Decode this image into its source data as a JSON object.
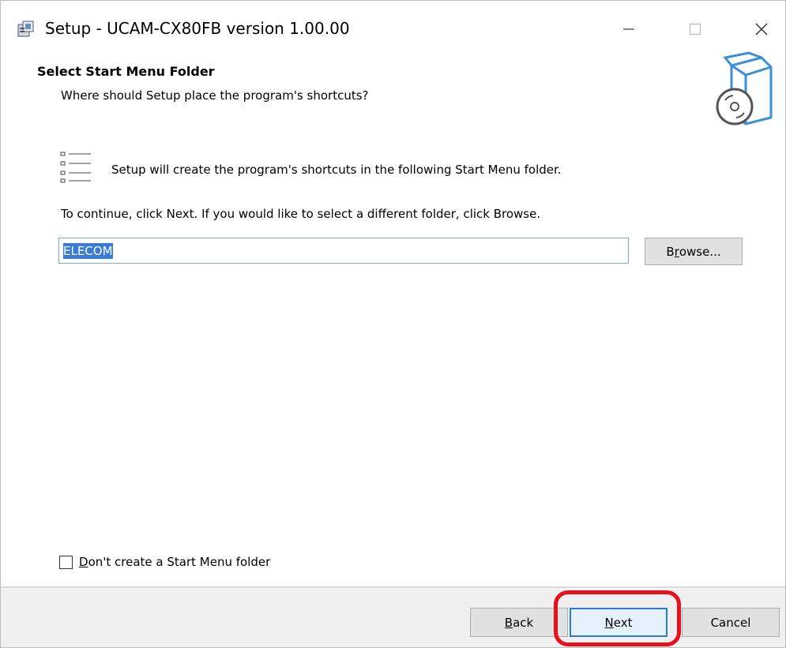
{
  "window": {
    "title": "Setup - UCAM-CX80FB version 1.00.00",
    "controls": {
      "minimize_icon": "minimize-icon",
      "maximize_icon": "maximize-icon",
      "close_icon": "close-icon"
    }
  },
  "header": {
    "title": "Select Start Menu Folder",
    "subtitle": "Where should Setup place the program's shortcuts?"
  },
  "content": {
    "info_text": "Setup will create the program's shortcuts in the following Start Menu folder.",
    "continue_text": "To continue, click Next. If you would like to select a different folder, click Browse.",
    "folder_value": "ELECOM",
    "browse_label_prefix": "B",
    "browse_label_underlined": "r",
    "browse_label_suffix": "owse...",
    "checkbox_underlined": "D",
    "checkbox_label_suffix": "on't create a Start Menu folder",
    "checkbox_checked": false
  },
  "footer": {
    "back_underlined": "B",
    "back_suffix": "ack",
    "next_underlined": "N",
    "next_suffix": "ext",
    "cancel_label": "Cancel"
  },
  "colors": {
    "highlight": "#e8101c",
    "selection": "#3a7bd5",
    "focus_border": "#2b79d8"
  }
}
